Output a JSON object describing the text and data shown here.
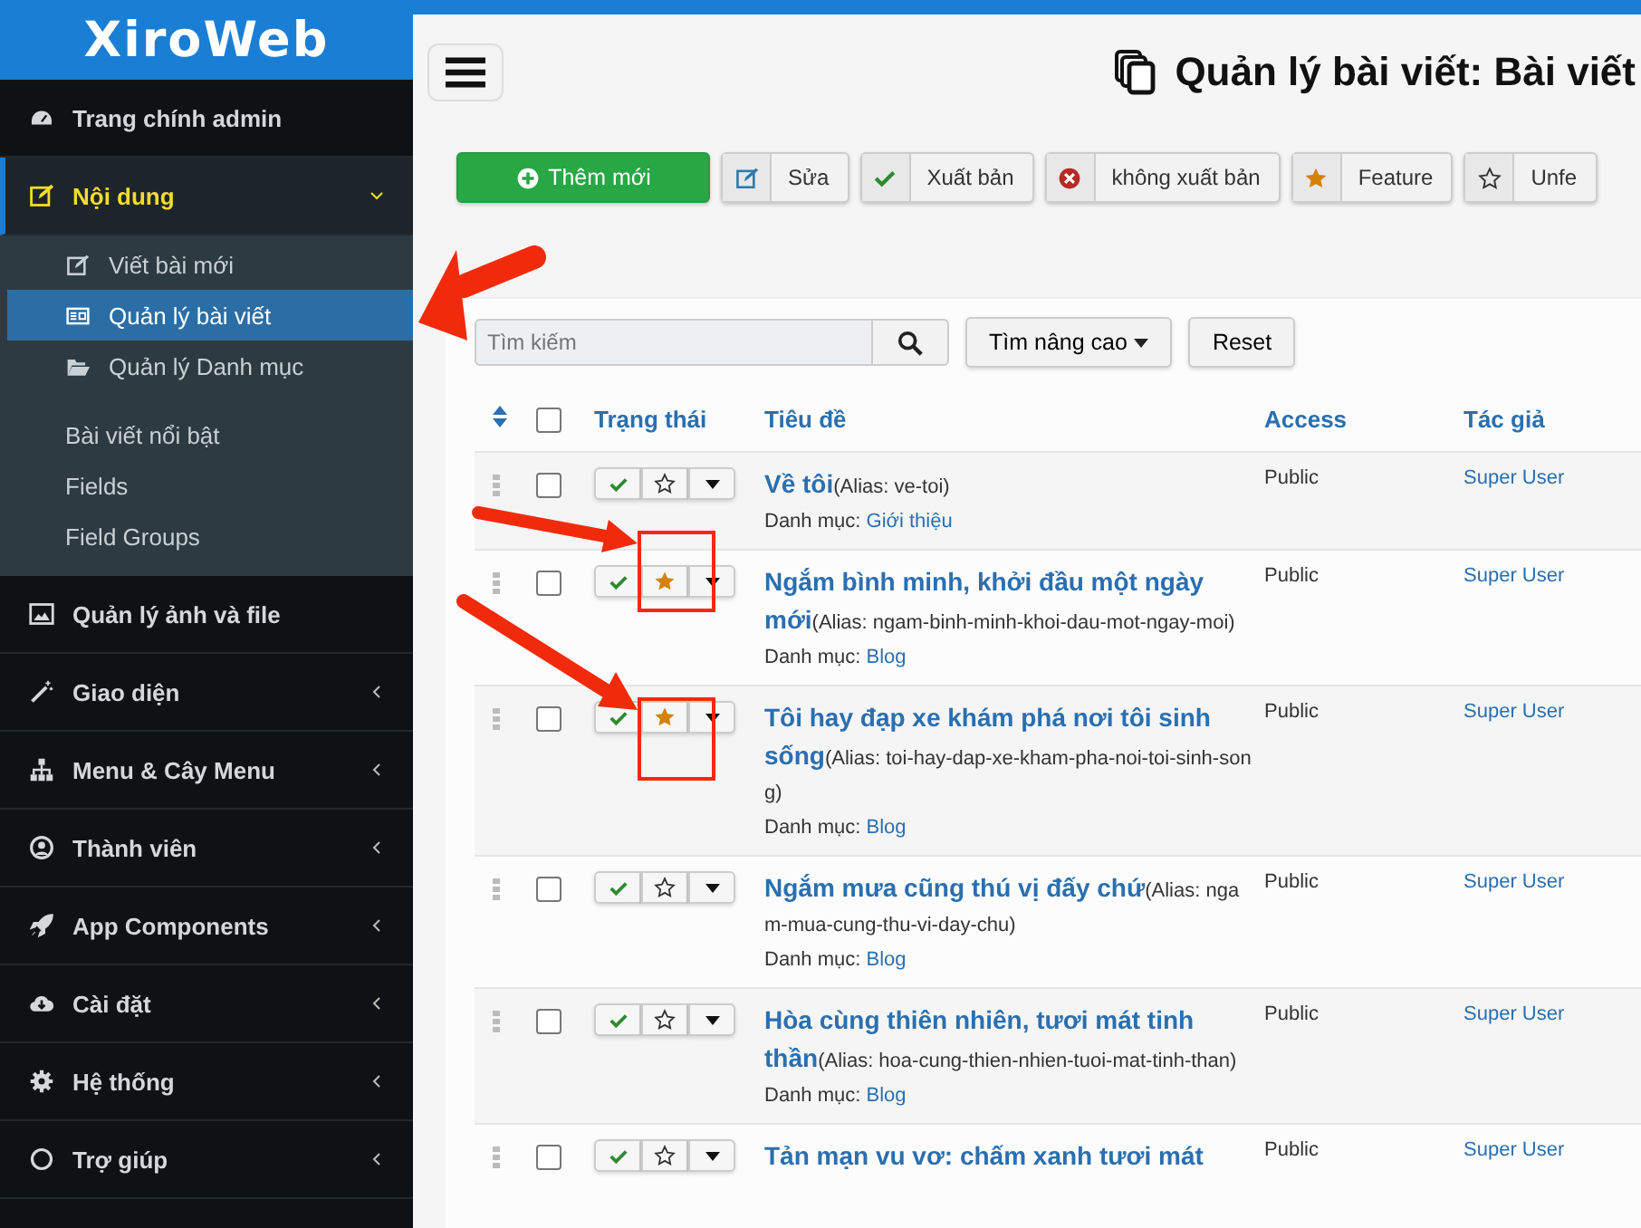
{
  "logo": "XiroWeb",
  "sidebar": {
    "items": [
      {
        "label": "Trang chính admin",
        "selected": false,
        "expanded": false,
        "has_caret": false
      },
      {
        "label": "Nội dung",
        "selected": true,
        "expanded": true,
        "has_caret": true,
        "children": [
          {
            "label": "Viết bài mới",
            "selected": false
          },
          {
            "label": "Quản lý bài viết",
            "selected": true
          },
          {
            "label": "Quản lý Danh mục",
            "selected": false
          },
          {
            "label": "Bài viết nổi bật",
            "selected": false
          },
          {
            "label": "Fields",
            "selected": false
          },
          {
            "label": "Field Groups",
            "selected": false
          }
        ]
      },
      {
        "label": "Quản lý ảnh và file",
        "selected": false,
        "expanded": false,
        "has_caret": false
      },
      {
        "label": "Giao diện",
        "selected": false,
        "expanded": false,
        "has_caret": true
      },
      {
        "label": "Menu & Cây Menu",
        "selected": false,
        "expanded": false,
        "has_caret": true
      },
      {
        "label": "Thành viên",
        "selected": false,
        "expanded": false,
        "has_caret": true
      },
      {
        "label": "App Components",
        "selected": false,
        "expanded": false,
        "has_caret": true
      },
      {
        "label": "Cài đặt",
        "selected": false,
        "expanded": false,
        "has_caret": true
      },
      {
        "label": "Hệ thống",
        "selected": false,
        "expanded": false,
        "has_caret": true
      },
      {
        "label": "Trợ giúp",
        "selected": false,
        "expanded": false,
        "has_caret": true
      }
    ]
  },
  "page_title": "Quản lý bài viết: Bài viết",
  "toolbar": [
    {
      "kind": "primary",
      "label": "Thêm mới"
    },
    {
      "kind": "default",
      "label": "Sửa"
    },
    {
      "kind": "default",
      "label": "Xuất bản"
    },
    {
      "kind": "default",
      "label": "không xuất bản"
    },
    {
      "kind": "default",
      "label": "Feature"
    },
    {
      "kind": "default",
      "label": "Unfe"
    }
  ],
  "search": {
    "placeholder": "Tìm kiếm",
    "advanced_button": "Tìm nâng cao",
    "reset_button": "Reset"
  },
  "table": {
    "select_all_checked": false,
    "columns": [
      "Trạng thái",
      "Tiêu đề",
      "Access",
      "Tác giả"
    ],
    "rows": [
      {
        "title": "Về tôi",
        "alias": "(Alias: ve-toi)",
        "category_label": "Danh mục:",
        "category": "Giới thiệu",
        "access": "Public",
        "author": "Super User",
        "published": true,
        "featured": false,
        "checked": false
      },
      {
        "title": "Ngắm bình minh, khởi đầu một ngày mới",
        "alias": "(Alias: ngam-binh-minh-khoi-dau-mot-ngay-moi)",
        "category_label": "Danh mục:",
        "category": "Blog",
        "access": "Public",
        "author": "Super User",
        "published": true,
        "featured": true,
        "checked": false
      },
      {
        "title": "Tôi hay đạp xe khám phá nơi tôi sinh sống",
        "alias": "(Alias: toi-hay-dap-xe-kham-pha-noi-toi-sinh-song)",
        "category_label": "Danh mục:",
        "category": "Blog",
        "access": "Public",
        "author": "Super User",
        "published": true,
        "featured": true,
        "checked": false
      },
      {
        "title": "Ngắm mưa cũng thú vị đấy chứ",
        "alias": "(Alias: ngam-mua-cung-thu-vi-day-chu)",
        "category_label": "Danh mục:",
        "category": "Blog",
        "access": "Public",
        "author": "Super User",
        "published": true,
        "featured": false,
        "checked": false
      },
      {
        "title": "Hòa cùng thiên nhiên, tươi mát tinh thần",
        "alias": "(Alias: hoa-cung-thien-nhien-tuoi-mat-tinh-than)",
        "category_label": "Danh mục:",
        "category": "Blog",
        "access": "Public",
        "author": "Super User",
        "published": true,
        "featured": false,
        "checked": false
      },
      {
        "title": "Tản mạn vu vơ: chấm xanh tươi mát",
        "access": "Public",
        "author": "Super User",
        "published": true,
        "featured": false,
        "checked": false
      }
    ]
  }
}
